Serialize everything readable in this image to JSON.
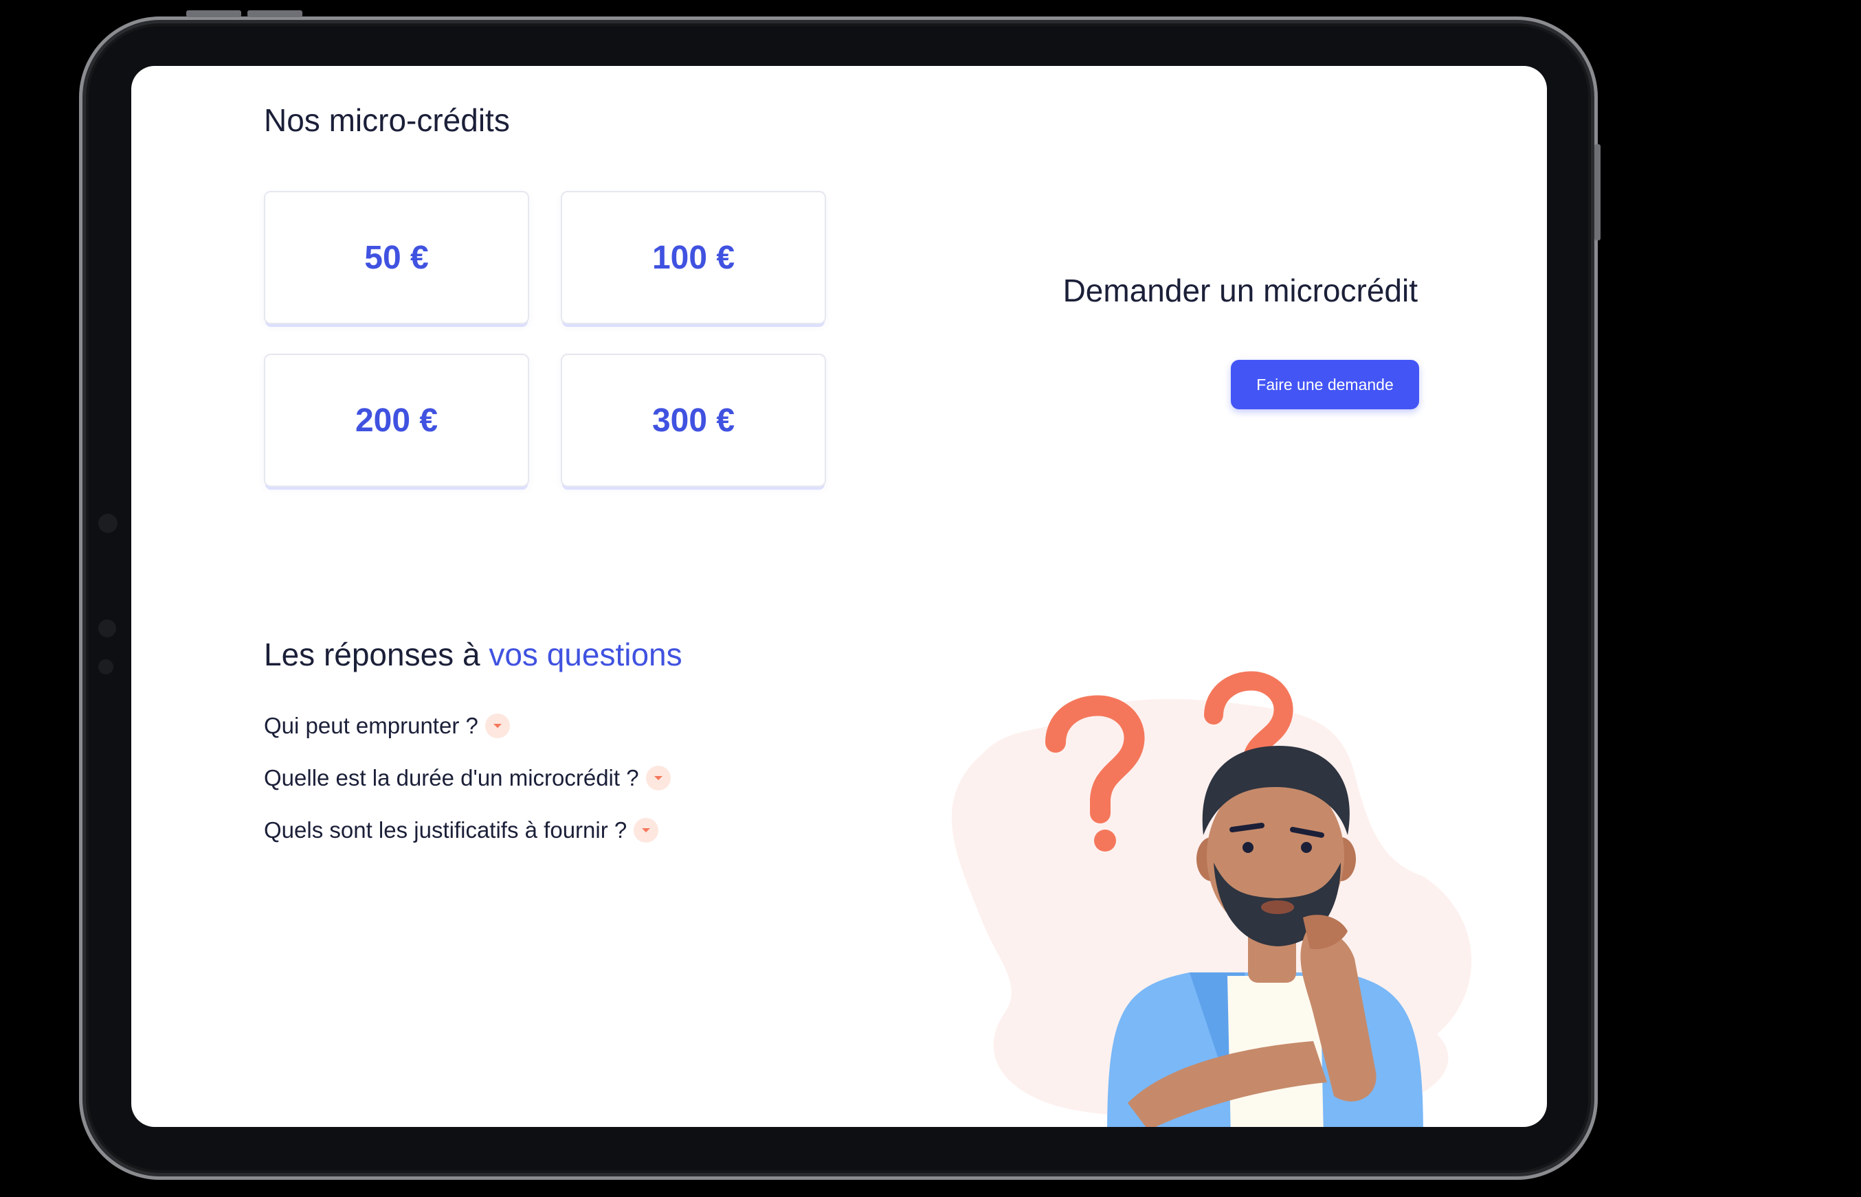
{
  "section_title": "Nos micro-crédits",
  "amounts": [
    "50 €",
    "100 €",
    "200 €",
    "300 €"
  ],
  "cta": {
    "title": "Demander un microcrédit",
    "button_label": "Faire une demande"
  },
  "faq": {
    "title_prefix": "Les réponses à ",
    "title_accent": "vos questions",
    "items": [
      "Qui peut emprunter ?",
      "Quelle est la durée d'un microcrédit ?",
      "Quels sont les justificatifs à fournir ?"
    ]
  },
  "colors": {
    "accent": "#4052e0",
    "button": "#4355f5",
    "text": "#1b1f38",
    "question_mark": "#f5775b"
  },
  "icons": {
    "faq_toggle": "chevron-down-icon",
    "illustration": "thinking-person-illustration"
  }
}
